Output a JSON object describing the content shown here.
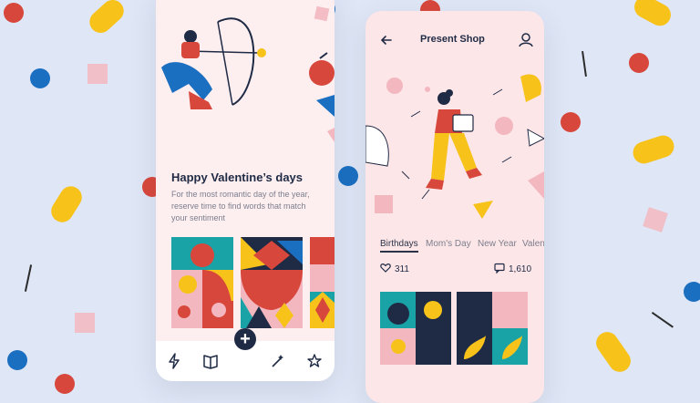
{
  "colors": {
    "background": "#dfe6f6",
    "navy": "#1f2a44",
    "yellow": "#f7c21a",
    "red": "#d8473b",
    "blue": "#1b6fc1",
    "pink": "#f3b7c0",
    "teal": "#1aa3a6"
  },
  "left_phone": {
    "title": "Happy Valentine’s days",
    "description_lines": [
      "For the most romantic day of the year,",
      "reserve time to find words that match",
      "your sentiment"
    ],
    "bottom_nav": {
      "items": [
        {
          "name": "lightning-icon"
        },
        {
          "name": "book-icon"
        },
        {
          "name": "add-button",
          "label": "+"
        },
        {
          "name": "magic-wand-icon"
        },
        {
          "name": "star-icon"
        }
      ]
    }
  },
  "right_phone": {
    "header": {
      "title": "Present Shop",
      "back_icon": "arrow-left-icon",
      "profile_icon": "user-icon"
    },
    "tabs": [
      "Birthdays",
      "Mom's Day",
      "New Year",
      "Valen"
    ],
    "stats": {
      "likes": "311",
      "comments": "1,610"
    }
  }
}
